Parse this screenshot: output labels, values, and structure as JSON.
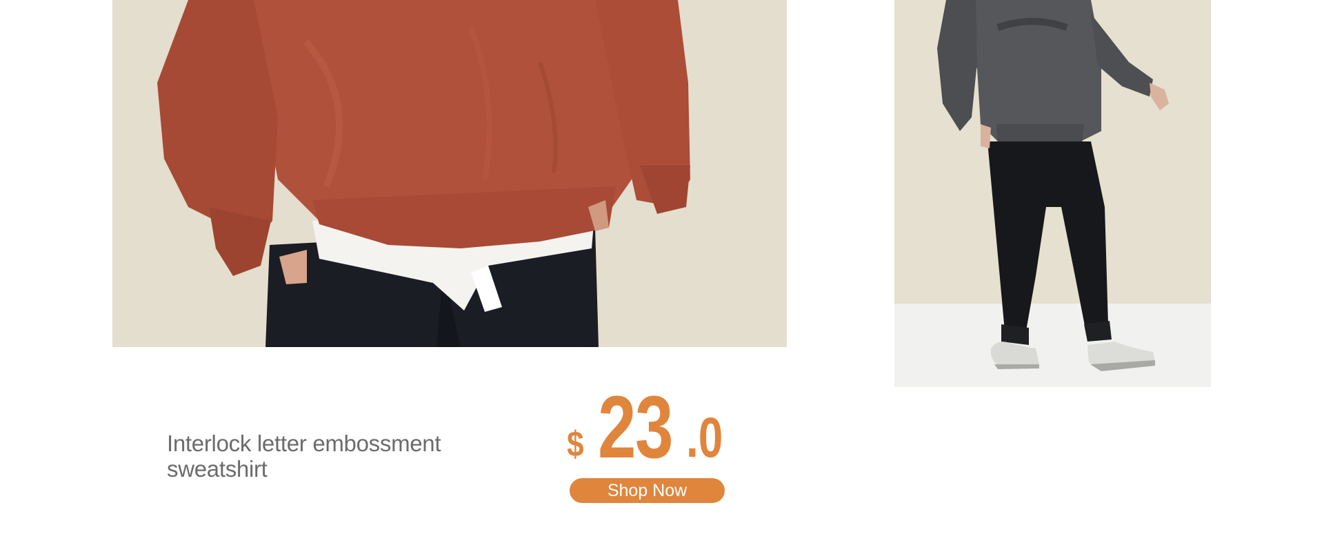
{
  "product": {
    "title": "Interlock letter embossment sweatshirt",
    "price_currency": "$",
    "price_integer": "23",
    "price_decimal": ".0",
    "shop_label": "Shop Now"
  },
  "images": {
    "main": "orange-sweatshirt-closeup",
    "side": "gray-sweatshirt-full-body"
  },
  "colors": {
    "accent": "#e0853c",
    "title_text": "#6b6b6b",
    "photo_background": "#e4dfcf"
  }
}
